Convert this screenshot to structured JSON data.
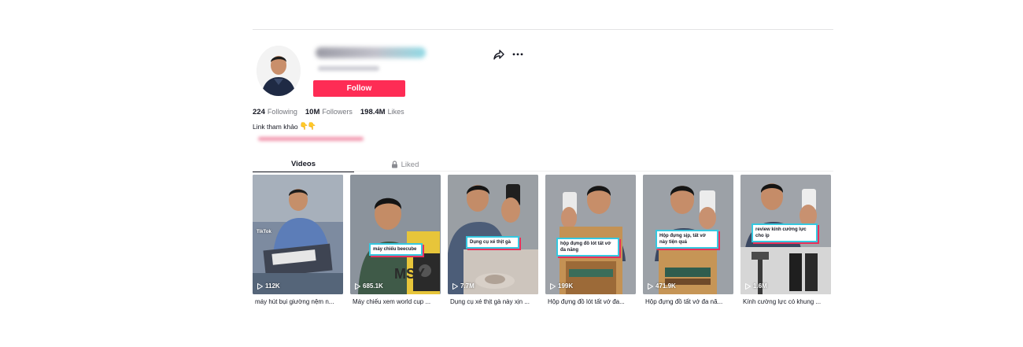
{
  "profile": {
    "follow_label": "Follow",
    "stats": [
      {
        "value": "224",
        "label": "Following"
      },
      {
        "value": "10M",
        "label": "Followers"
      },
      {
        "value": "198.4M",
        "label": "Likes"
      }
    ],
    "bio": "Link tham khảo",
    "bio_emoji": "👇👇"
  },
  "tabs": [
    {
      "label": "Videos",
      "active": true
    },
    {
      "label": "Liked",
      "active": false,
      "icon": "lock-icon"
    }
  ],
  "colors": {
    "follow": "#fe2c55",
    "caption_border": "#36c8e0",
    "caption_shadow": "#ea2f5a"
  },
  "videos": [
    {
      "views": "112K",
      "title": "máy hút bụi giường nệm n...",
      "caption": "",
      "watermark": "TikTok"
    },
    {
      "views": "685.1K",
      "title": "Máy chiếu xem world cup ...",
      "caption": "máy chiếu beecube"
    },
    {
      "views": "7.7M",
      "title": "Dụng cụ xé thịt gà này xịn ...",
      "caption": "Dụng cụ xé thịt gà"
    },
    {
      "views": "199K",
      "title": "Hộp đựng đồ lót tất vớ đa...",
      "caption": "hộp đựng đồ lót tất vớ đa năng"
    },
    {
      "views": "471.9K",
      "title": "Hộp đựng đồ tất vớ đa nă...",
      "caption": "Hộp đựng sịp, tất vớ này tiện quá"
    },
    {
      "views": "1.6M",
      "title": "Kính cường lực có khung ...",
      "caption": "review kính cường lực cho ip"
    }
  ]
}
